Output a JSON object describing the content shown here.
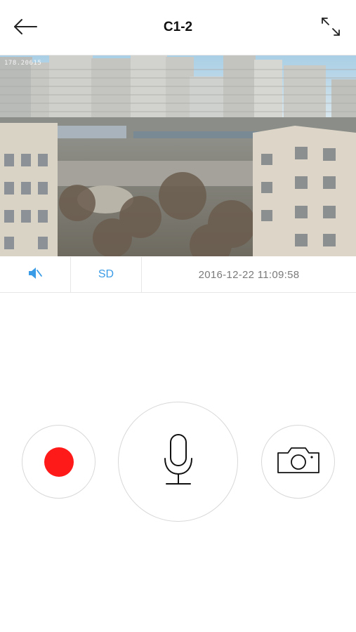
{
  "header": {
    "title": "C1-2",
    "back_icon": "arrow-left-icon",
    "fullscreen_icon": "expand-icon"
  },
  "video": {
    "osd_overlay": "178.20615"
  },
  "control_bar": {
    "mute_icon": "speaker-muted-icon",
    "quality_label": "SD",
    "timestamp": "2016-12-22 11:09:58"
  },
  "actions": {
    "record_icon": "record-icon",
    "mic_icon": "microphone-icon",
    "snapshot_icon": "camera-icon"
  },
  "colors": {
    "accent": "#3a9be6",
    "record": "#ff1a1a",
    "timestamp_text": "#7a7a7a",
    "border": "#d8d8d8"
  }
}
